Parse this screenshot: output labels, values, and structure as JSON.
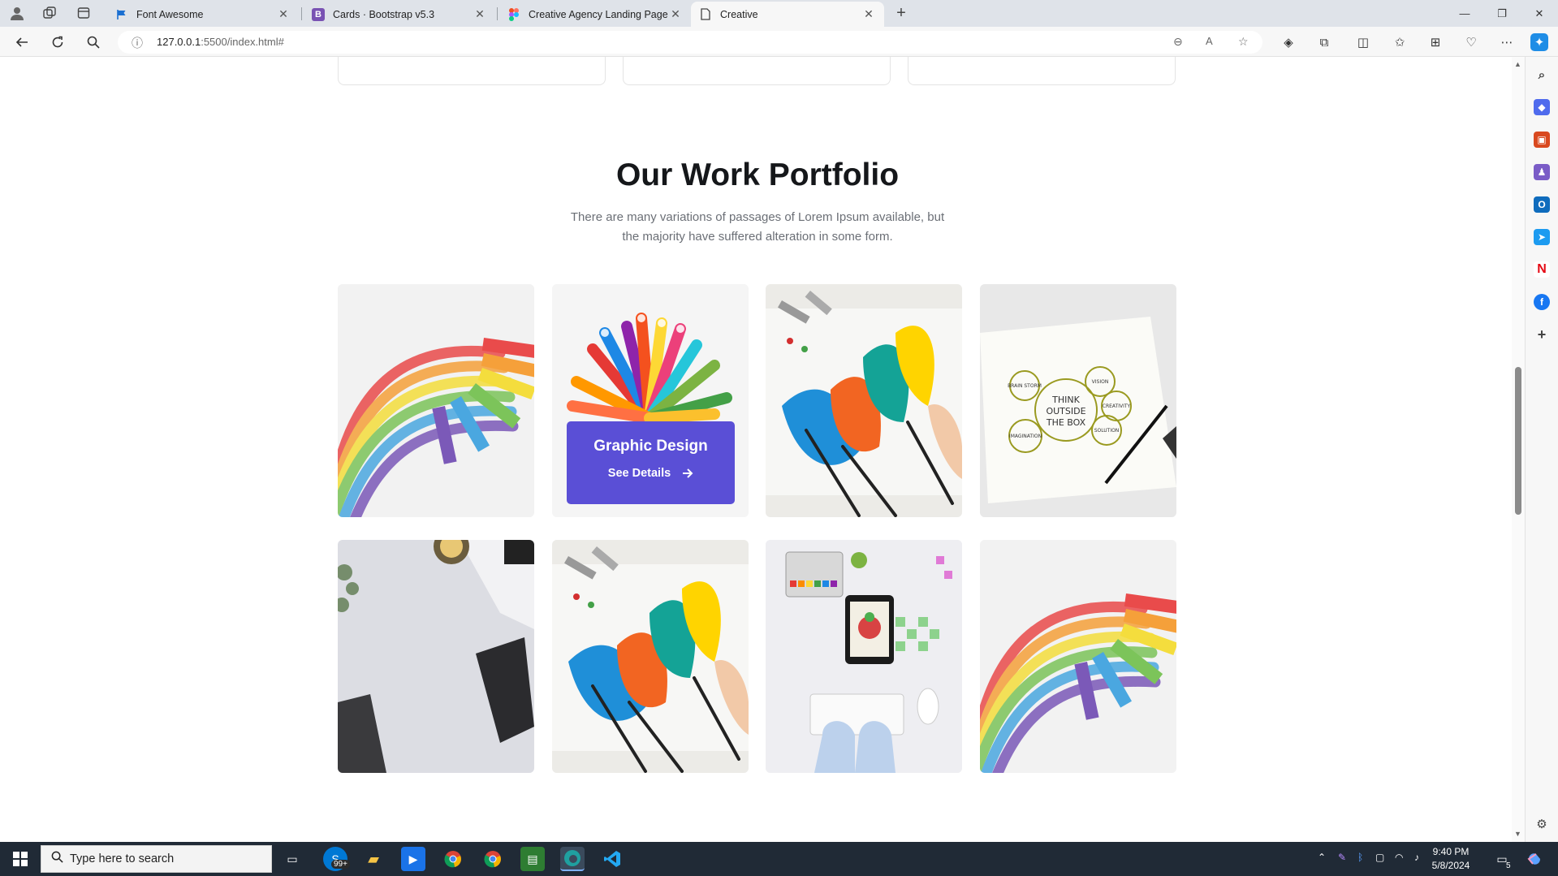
{
  "browser": {
    "tabs": [
      {
        "title": "Font Awesome",
        "favicon": "font-awesome-flag",
        "active": false
      },
      {
        "title": "Cards · Bootstrap v5.3",
        "favicon": "bootstrap-b",
        "active": false
      },
      {
        "title": "Creative Agency Landing Page D",
        "favicon": "figma-logo",
        "active": false
      },
      {
        "title": "Creative",
        "favicon": "page-icon",
        "active": true
      }
    ],
    "url_host": "127.0.0.1",
    "url_rest": ":5500/index.html#"
  },
  "portfolio": {
    "title": "Our Work Portfolio",
    "description": "There are many variations of passages of Lorem Ipsum available, but the majority have suffered alteration in some form.",
    "hover_card": {
      "title": "Graphic Design",
      "link_label": "See Details",
      "link_icon": "arrow-right-icon",
      "background": "#5a4fd6"
    },
    "items": [
      {
        "image": "rainbow-chalk",
        "hovered": false
      },
      {
        "image": "colored-markers",
        "hovered": true
      },
      {
        "image": "paint-brushes",
        "hovered": false
      },
      {
        "image": "think-outside-the-box-sketch",
        "hovered": false
      },
      {
        "image": "desk-laptop",
        "hovered": false
      },
      {
        "image": "paint-brushes",
        "hovered": false
      },
      {
        "image": "designer-tablet-keyboard",
        "hovered": false
      },
      {
        "image": "rainbow-chalk",
        "hovered": false
      }
    ],
    "sketch_text": {
      "center": [
        "THINK",
        "OUTSIDE",
        "THE BOX"
      ],
      "bubbles": [
        "BRAIN STORM",
        "VISION",
        "CREATIVITY",
        "SOLUTION",
        "IMAGINATION"
      ]
    }
  },
  "taskbar": {
    "search_placeholder": "Type here to search",
    "badge": "99+",
    "time": "9:40 PM",
    "date": "5/8/2024",
    "notification_count": "5"
  }
}
